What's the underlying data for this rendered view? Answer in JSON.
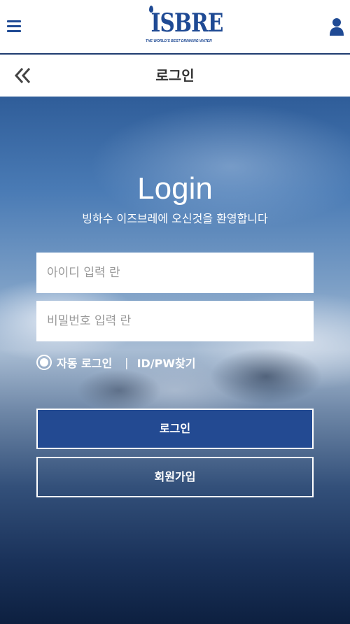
{
  "header": {
    "logo_text": "ISBRE",
    "logo_tagline": "THE WORLD'S BEST DRINKING WATER",
    "menu_icon": "hamburger-menu-icon",
    "user_icon": "user-icon"
  },
  "subheader": {
    "title": "로그인",
    "back_icon": "double-chevron-left-icon"
  },
  "login": {
    "title": "Login",
    "welcome": "빙하수 이즈브레에 오신것을 환영합니다",
    "id_placeholder": "아이디 입력 란",
    "pw_placeholder": "비밀번호 입력 란",
    "auto_login_label": "자동 로그인",
    "separator": "|",
    "find_link": "ID/PW찾기",
    "login_button": "로그인",
    "join_button": "회원가입"
  },
  "colors": {
    "brand": "#1f4a94",
    "login_button_bg": "#234a92",
    "text_on_hero": "#ffffff"
  }
}
